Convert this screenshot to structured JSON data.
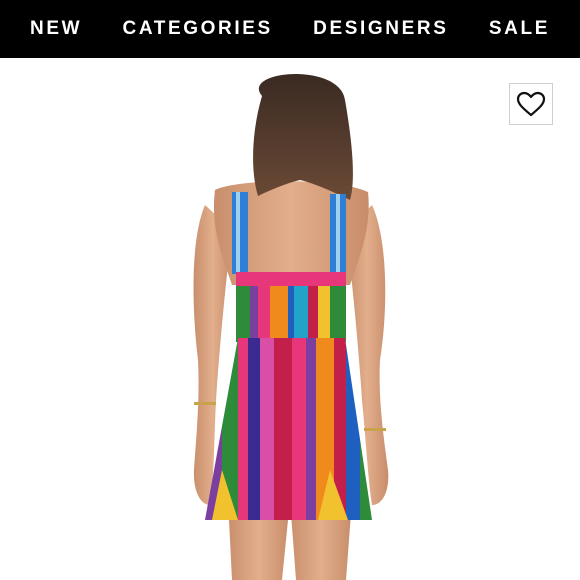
{
  "nav": {
    "items": [
      {
        "label": "NEW"
      },
      {
        "label": "CATEGORIES"
      },
      {
        "label": "DESIGNERS"
      },
      {
        "label": "SALE"
      }
    ]
  },
  "product": {
    "image_icon": "dress-back-view-image",
    "stripe_colors": [
      "#2e8b3a",
      "#7b3fa0",
      "#e8367a",
      "#f08a1c",
      "#1f5fbf",
      "#c21f4a",
      "#f2c12e",
      "#3b2a8f",
      "#d94ea6",
      "#23a3c8"
    ]
  },
  "like_button": {
    "icon": "heart-icon"
  },
  "colors": {
    "nav_background": "#000000",
    "nav_text": "#ffffff",
    "page_background": "#ffffff"
  }
}
